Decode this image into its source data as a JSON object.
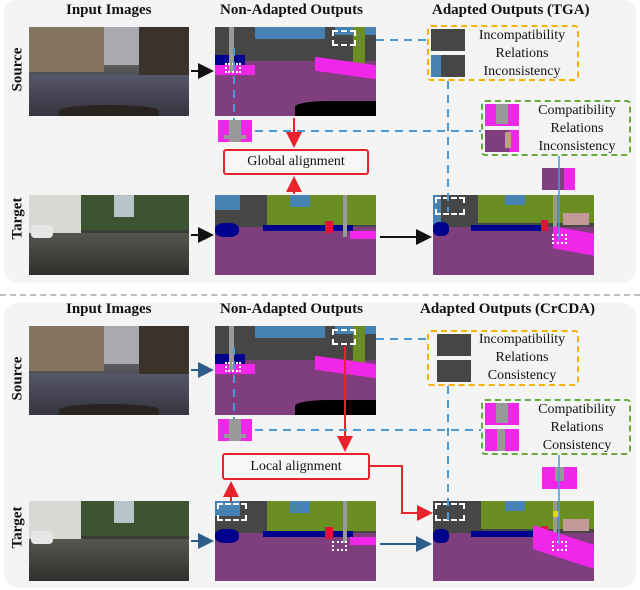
{
  "top_panel": {
    "headers": {
      "input": "Input Images",
      "nonadapted": "Non-Adapted Outputs",
      "adapted": "Adapted Outputs (TGA)"
    },
    "rows": {
      "source": "Source",
      "target": "Target"
    },
    "alignment_label": "Global alignment",
    "incompat_box": [
      "Incompatibility",
      "Relations",
      "Inconsistency"
    ],
    "compat_box": [
      "Compatibility",
      "Relations",
      "Inconsistency"
    ]
  },
  "bottom_panel": {
    "headers": {
      "input": "Input Images",
      "nonadapted": "Non-Adapted Outputs",
      "adapted": "Adapted Outputs (CrCDA)"
    },
    "rows": {
      "source": "Source",
      "target": "Target"
    },
    "alignment_label": "Local alignment",
    "incompat_box": [
      "Incompatibility",
      "Relations",
      "Consistency"
    ],
    "compat_box": [
      "Compatibility",
      "Relations",
      "Consistency"
    ]
  },
  "colors": {
    "road": "#7f3f7f",
    "sidewalk": "#f026e8",
    "building": "#464646",
    "vegetation": "#6b8e23",
    "sky": "#4682b4",
    "car": "#00008e",
    "person": "#dc143c",
    "pole": "#999999",
    "alignment_red": "#e8232b",
    "incompat_yellow": "#f5b300",
    "compat_green": "#6aaa3a",
    "link_blue": "#4a9ad8"
  }
}
